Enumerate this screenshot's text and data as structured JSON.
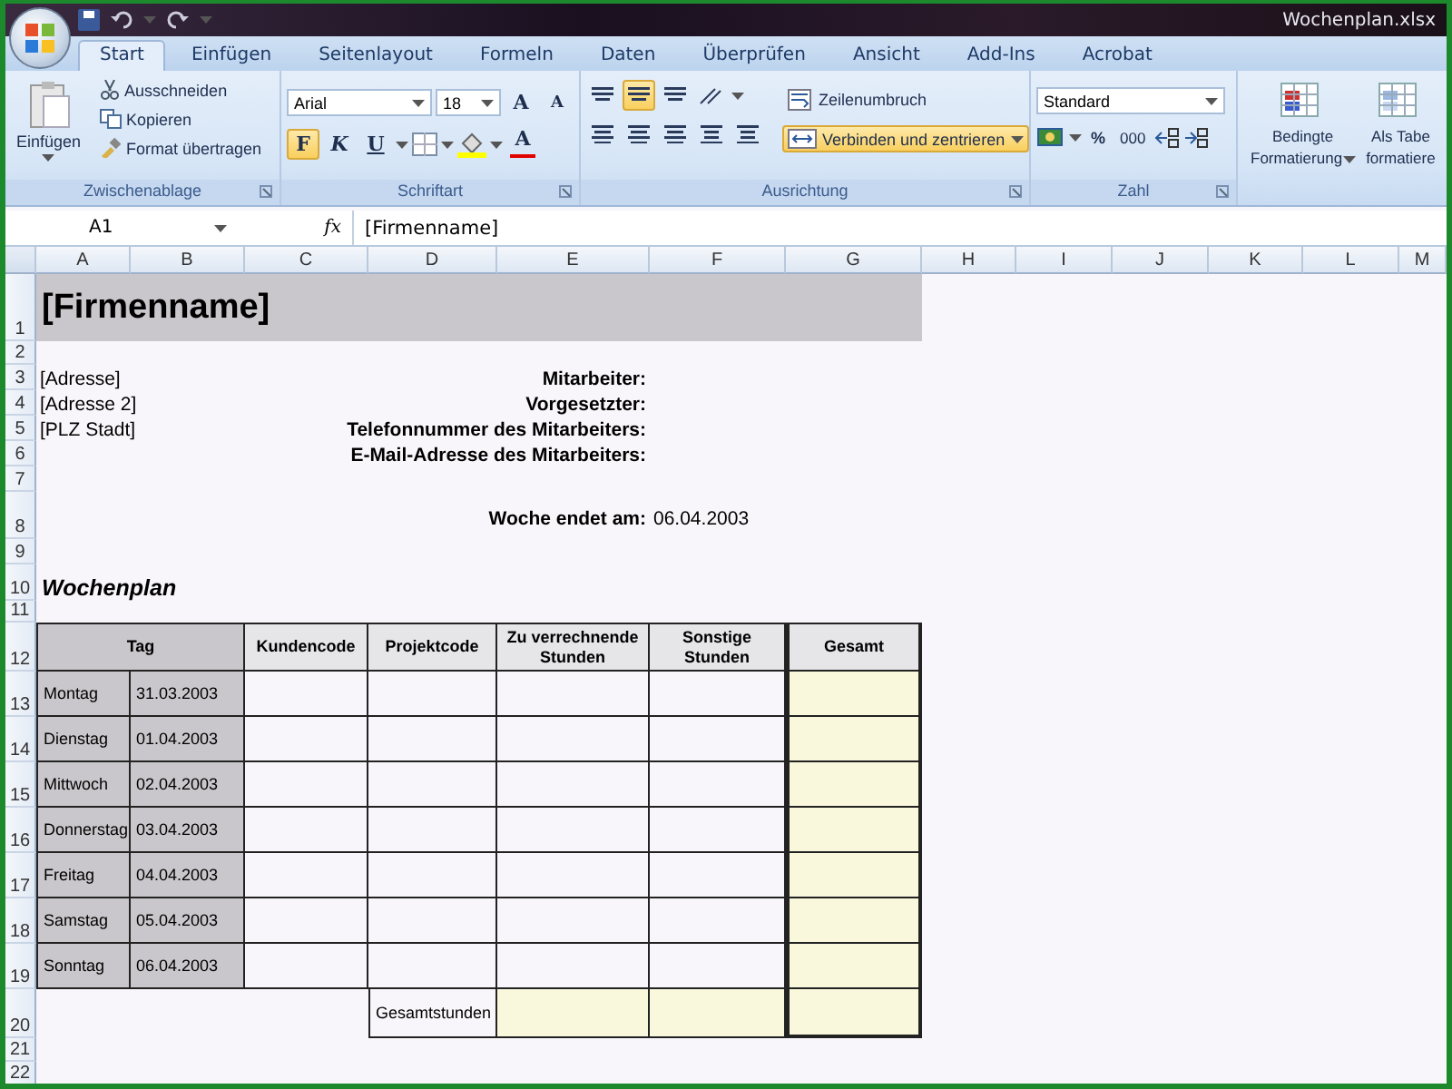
{
  "window": {
    "title": "Wochenplan.xlsx"
  },
  "tabs": [
    {
      "label": "Start",
      "selected": true
    },
    {
      "label": "Einfügen",
      "selected": false
    },
    {
      "label": "Seitenlayout",
      "selected": false
    },
    {
      "label": "Formeln",
      "selected": false
    },
    {
      "label": "Daten",
      "selected": false
    },
    {
      "label": "Überprüfen",
      "selected": false
    },
    {
      "label": "Ansicht",
      "selected": false
    },
    {
      "label": "Add-Ins",
      "selected": false
    },
    {
      "label": "Acrobat",
      "selected": false
    }
  ],
  "ribbon": {
    "clipboard": {
      "label": "Zwischenablage",
      "paste": "Einfügen",
      "actions": [
        {
          "kind": "cut",
          "label": "Ausschneiden"
        },
        {
          "kind": "copy",
          "label": "Kopieren"
        },
        {
          "kind": "painter",
          "label": "Format übertragen"
        }
      ]
    },
    "font": {
      "label": "Schriftart",
      "font": "Arial",
      "size": "18",
      "grow": "A",
      "shrink": "A",
      "styles": [
        {
          "label": "F",
          "kind": "bold",
          "selected": true
        },
        {
          "label": "K",
          "kind": "italic",
          "selected": false
        },
        {
          "label": "U",
          "kind": "underline",
          "selected": false
        }
      ],
      "font_color": "A"
    },
    "alignment": {
      "label": "Ausrichtung",
      "vertical": [
        {
          "selected": false
        },
        {
          "selected": true
        },
        {
          "selected": false
        }
      ],
      "wrap": "Zeilenumbruch",
      "merge": {
        "label": "Verbinden und zentrieren",
        "selected": true
      }
    },
    "number": {
      "label": "Zahl",
      "format": "Standard",
      "percent": "%",
      "thousands": "000"
    },
    "styles": {
      "buttons": [
        {
          "lines": [
            "Bedingte",
            "Formatierung"
          ]
        },
        {
          "lines": [
            "Als Tabe",
            "formatiere"
          ]
        }
      ]
    }
  },
  "formula_bar": {
    "name_box": "A1",
    "function_label": "fx",
    "value": "[Firmenname]"
  },
  "columns": [
    "A",
    "B",
    "C",
    "D",
    "E",
    "F",
    "G",
    "H",
    "I",
    "J",
    "K",
    "L",
    "M"
  ],
  "rows": [
    "1",
    "2",
    "3",
    "4",
    "5",
    "6",
    "7",
    "8",
    "9",
    "10",
    "11",
    "12",
    "13",
    "14",
    "15",
    "16",
    "17",
    "18",
    "19",
    "20",
    "21",
    "22"
  ],
  "sheet": {
    "company_name": "[Firmenname]",
    "address_lines": [
      "[Adresse]",
      "[Adresse 2]",
      "[PLZ Stadt]"
    ],
    "employee_labels": [
      "Mitarbeiter:",
      "Vorgesetzter:",
      "Telefonnummer des Mitarbeiters:",
      "E-Mail-Adresse des Mitarbeiters:"
    ],
    "week_end": {
      "label": "Woche endet am:",
      "value": "06.04.2003"
    },
    "section_title": "Wochenplan",
    "timesheet": {
      "columns": [
        "Tag",
        "Kundencode",
        "Projektcode",
        "Zu verrechnende Stunden",
        "Sonstige Stunden",
        "Gesamt"
      ],
      "days": [
        {
          "day": "Montag",
          "date": "31.03.2003"
        },
        {
          "day": "Dienstag",
          "date": "01.04.2003"
        },
        {
          "day": "Mittwoch",
          "date": "02.04.2003"
        },
        {
          "day": "Donnerstag",
          "date": "03.04.2003"
        },
        {
          "day": "Freitag",
          "date": "04.04.2003"
        },
        {
          "day": "Samstag",
          "date": "05.04.2003"
        },
        {
          "day": "Sonntag",
          "date": "06.04.2003"
        }
      ],
      "total_label": "Gesamtstunden"
    }
  }
}
